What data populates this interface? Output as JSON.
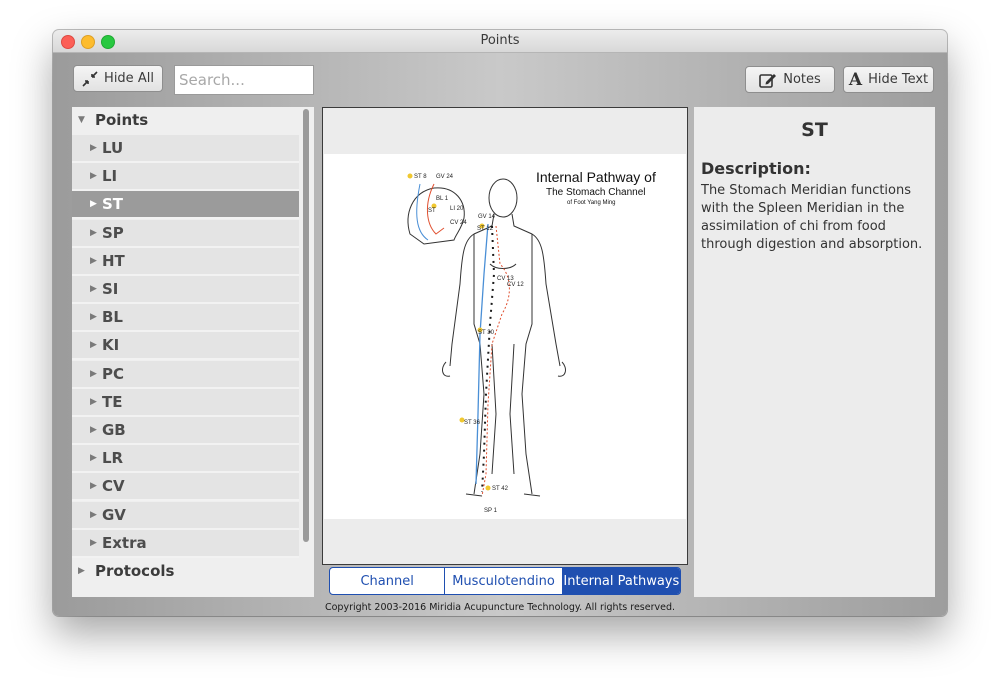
{
  "window": {
    "title": "Points"
  },
  "toolbar": {
    "hide_all_label": "Hide All",
    "search_placeholder": "Search...",
    "notes_label": "Notes",
    "hide_text_label": "Hide Text"
  },
  "sidebar": {
    "points_label": "Points",
    "items": [
      "LU",
      "LI",
      "ST",
      "SP",
      "HT",
      "SI",
      "BL",
      "KI",
      "PC",
      "TE",
      "GB",
      "LR",
      "CV",
      "GV",
      "Extra"
    ],
    "selected": "ST",
    "protocols_label": "Protocols"
  },
  "diagram": {
    "title": "Internal Pathway of",
    "subtitle": "The Stomach Channel",
    "subtitle2": "of Foot Yang Ming",
    "point_labels": [
      "ST 8",
      "GV 24",
      "BL 1",
      "LI 20",
      "ST",
      "CV 24",
      "GV 14",
      "ST 12",
      "CV 13",
      "CV 12",
      "ST 30",
      "ST 36",
      "ST 42",
      "SP 1"
    ]
  },
  "tabs": [
    "Channel",
    "Musculotendino",
    "Internal Pathways"
  ],
  "active_tab": "Internal Pathways",
  "description": {
    "title": "ST",
    "label": "Description:",
    "text": "The Stomach Meridian functions with the Spleen Meridian in the assimilation of chi from food through digestion and absorption."
  },
  "footer": {
    "copyright": "Copyright 2003-2016 Miridia Acupuncture Technology.  All rights reserved."
  },
  "colors": {
    "accent": "#1f4fb0",
    "selected_row": "#9b9b9b"
  }
}
